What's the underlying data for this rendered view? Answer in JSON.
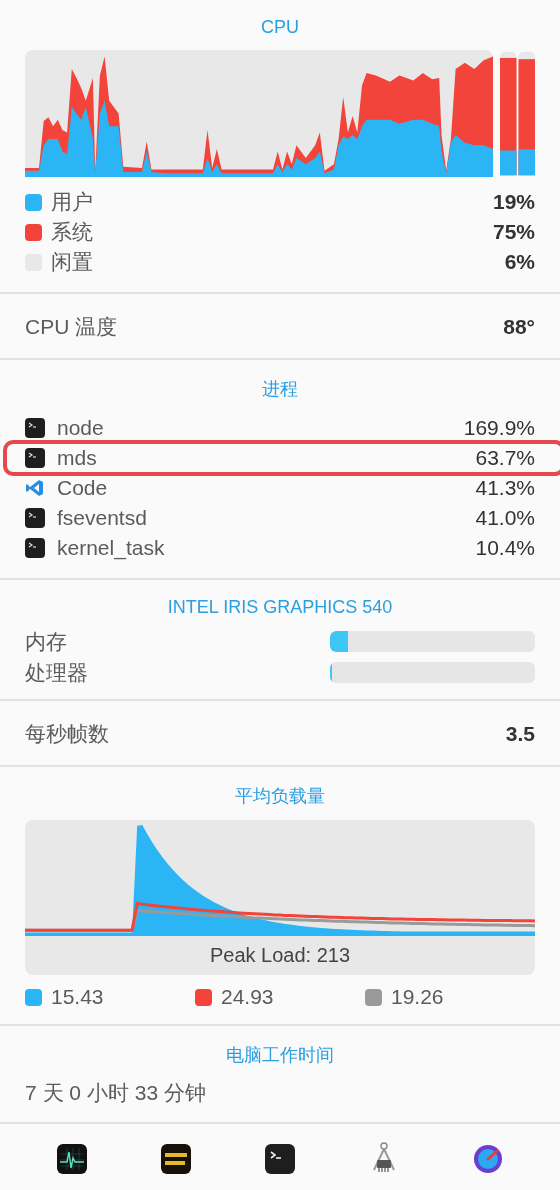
{
  "cpu": {
    "title": "CPU",
    "legend": [
      {
        "label": "用户",
        "value": "19%",
        "color": "#2bb5f5"
      },
      {
        "label": "系统",
        "value": "75%",
        "color": "#f2443a"
      },
      {
        "label": "闲置",
        "value": "6%",
        "color": "#e8e8e8"
      }
    ]
  },
  "cpu_temperature": {
    "label": "CPU 温度",
    "value": "88°"
  },
  "processes": {
    "title": "进程",
    "items": [
      {
        "name": "node",
        "value": "169.9%",
        "kind": "terminal",
        "highlighted": false
      },
      {
        "name": "mds",
        "value": "63.7%",
        "kind": "terminal",
        "highlighted": true
      },
      {
        "name": "Code",
        "value": "41.3%",
        "kind": "code",
        "highlighted": false
      },
      {
        "name": "fseventsd",
        "value": "41.0%",
        "kind": "terminal",
        "highlighted": false
      },
      {
        "name": "kernel_task",
        "value": "10.4%",
        "kind": "terminal",
        "highlighted": false
      }
    ]
  },
  "gpu": {
    "title": "INTEL IRIS GRAPHICS 540",
    "meters": [
      {
        "label": "内存",
        "level": 0.09
      },
      {
        "label": "处理器",
        "level": 0.01
      }
    ]
  },
  "fps": {
    "label": "每秒帧数",
    "value": "3.5"
  },
  "load_average": {
    "title": "平均负载量",
    "peak_label": "Peak Load: 213",
    "legend": [
      {
        "value": "15.43",
        "color": "#2bb5f5"
      },
      {
        "value": "24.93",
        "color": "#f2443a"
      },
      {
        "value": "19.26",
        "color": "#9a9a9a"
      }
    ]
  },
  "uptime": {
    "title": "电脑工作时间",
    "value": "7 天 0 小时 33 分钟"
  }
}
